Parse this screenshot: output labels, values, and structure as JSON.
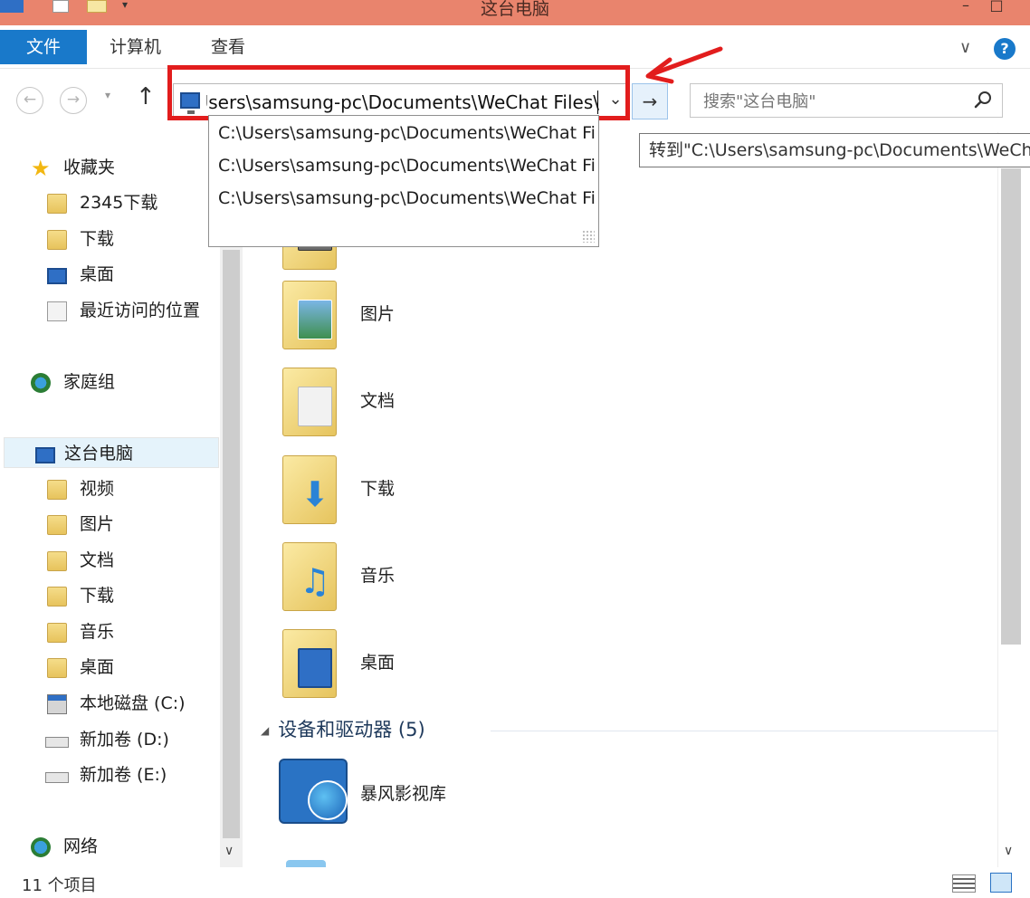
{
  "window": {
    "title": "这台电脑",
    "minimize_glyph": "–",
    "maximize_glyph": "□",
    "qa_more_glyph": "▾"
  },
  "ribbon": {
    "tabs": [
      "文件",
      "计算机",
      "查看"
    ],
    "chevron_glyph": "∨",
    "help_glyph": "?"
  },
  "navigation": {
    "back_glyph": "←",
    "forward_glyph": "→",
    "recent_glyph": "▾",
    "up_glyph": "↑",
    "address_value": "C:\\Users\\samsung-pc\\Documents\\WeChat Files\\",
    "address_dropdown_glyph": "⌄",
    "go_glyph": "→",
    "go_tooltip": "转到\"C:\\Users\\samsung-pc\\Documents\\WeChat Files\\",
    "search_placeholder": "搜索\"这台电脑\""
  },
  "autocomplete": {
    "items": [
      "C:\\Users\\samsung-pc\\Documents\\WeChat Files\\",
      "C:\\Users\\samsung-pc\\Documents\\WeChat Files\\",
      "C:\\Users\\samsung-pc\\Documents\\WeChat Files\\"
    ]
  },
  "sidebar": {
    "favorites": {
      "label": "收藏夹",
      "items": [
        "2345下载",
        "下载",
        "桌面",
        "最近访问的位置"
      ]
    },
    "homegroup": {
      "label": "家庭组"
    },
    "this_pc": {
      "label": "这台电脑",
      "items": [
        "视频",
        "图片",
        "文档",
        "下载",
        "音乐",
        "桌面",
        "本地磁盘 (C:)",
        "新加卷 (D:)",
        "新加卷 (E:)"
      ]
    },
    "network": {
      "label": "网络"
    },
    "scroll_down_glyph": "∨"
  },
  "content": {
    "folders": [
      "图片",
      "文档",
      "下载",
      "音乐",
      "桌面"
    ],
    "devices_group": {
      "arrow_glyph": "◢",
      "label": "设备和驱动器 (5)"
    },
    "devices": [
      "暴风影视库"
    ],
    "scroll_down_glyph": "∨"
  },
  "statusbar": {
    "item_count": "11 个项目"
  },
  "colors": {
    "titlebar": "#e9846d",
    "file_tab": "#1979ca",
    "highlight": "#e21d1d",
    "selection": "#e5f3fb"
  },
  "icons": {
    "favorites": "star-icon",
    "homegroup": "homegroup-icon",
    "this_pc": "computer-icon",
    "network": "network-icon",
    "search": "search-icon"
  }
}
